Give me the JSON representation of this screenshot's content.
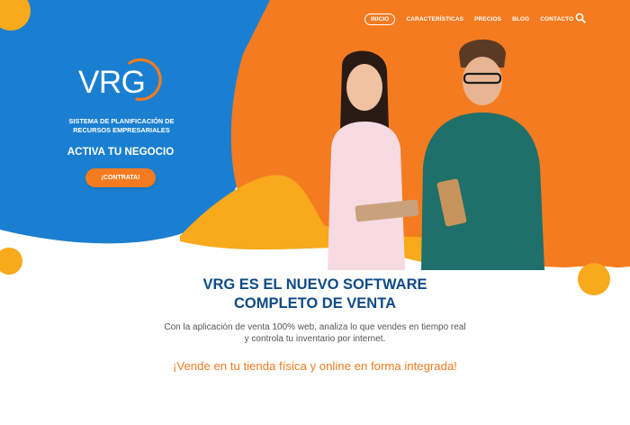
{
  "nav": {
    "items": [
      "INICIO",
      "CARACTERÍSTICAS",
      "PRECIOS",
      "BLOG",
      "CONTACTO"
    ],
    "active_index": 0,
    "search_icon": "search-icon"
  },
  "hero": {
    "logo_text": "VRG",
    "tagline_line1": "SISTEMA DE PLANIFICACIÓN DE",
    "tagline_line2": "RECURSOS EMPRESARIALES",
    "cta_title": "ACTIVA TU NEGOCIO",
    "cta_button": "¡CONTRATA!"
  },
  "main": {
    "headline_line1": "VRG ES EL NUEVO SOFTWARE",
    "headline_line2": "COMPLETO DE VENTA",
    "desc_line1": "Con la aplicación de venta 100% web, analiza lo que vendes en tiempo real",
    "desc_line2": "y controla tu inventario por internet.",
    "highlight": "¡Vende en tu tienda física y online en forma integrada!"
  },
  "colors": {
    "blue": "#1a7fd0",
    "orange": "#f47b20",
    "yellow": "#f8a91c",
    "navy": "#0f4a86"
  }
}
